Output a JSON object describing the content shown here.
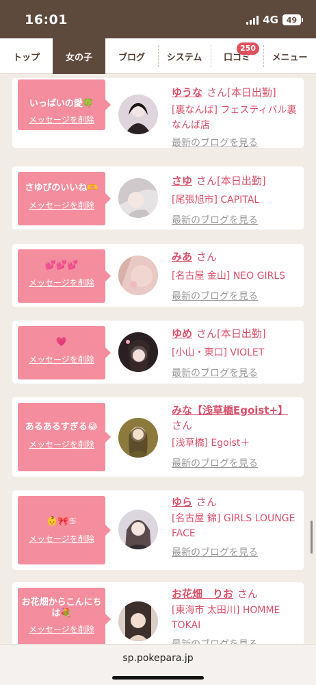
{
  "status": {
    "time": "16:01",
    "network": "4G",
    "battery": "49"
  },
  "nav": {
    "tabs": [
      {
        "label": "トップ"
      },
      {
        "label": "女の子"
      },
      {
        "label": "ブログ"
      },
      {
        "label": "システム"
      },
      {
        "label": "口コミ",
        "badge": "250"
      },
      {
        "label": "メニュー"
      }
    ]
  },
  "cards": [
    {
      "message": "いっぱいの愛🍀",
      "delete_label": "メッセージを削除",
      "name": "ゆうな",
      "honorific": "さん",
      "status": "[本日出勤]",
      "shop": "[裏なんば] フェスティバル裏なんば店",
      "blog_label": "最新のブログを見る"
    },
    {
      "message": "さゆぴのいいね🫶",
      "delete_label": "メッセージを削除",
      "name": "さゆ",
      "honorific": "さん",
      "status": "[本日出勤]",
      "shop": "[尾張旭市] CAPITAL",
      "blog_label": "最新のブログを見る"
    },
    {
      "message": "💕💕💕",
      "delete_label": "メッセージを削除",
      "name": "みあ",
      "honorific": "さん",
      "status": "",
      "shop": "[名古屋 金山] NEO GIRLS",
      "blog_label": "最新のブログを見る"
    },
    {
      "message": "💗",
      "delete_label": "メッセージを削除",
      "name": "ゆめ",
      "honorific": "さん",
      "status": "[本日出勤]",
      "shop": "[小山・東口] VIOLET",
      "blog_label": "最新のブログを見る"
    },
    {
      "message": "あるあるすぎる😂",
      "delete_label": "メッセージを削除",
      "name": "みな【浅草橋Egoist+】",
      "honorific": "さん",
      "status": "",
      "shop": "[浅草橋] Egoist＋",
      "blog_label": "最新のブログを見る"
    },
    {
      "message": "👶🎀♋",
      "delete_label": "メッセージを削除",
      "name": "ゆら",
      "honorific": "さん",
      "status": "",
      "shop": "[名古屋 錦] GIRLS LOUNGE FACE",
      "blog_label": "最新のブログを見る"
    },
    {
      "message": "お花畑からこんにちは💐",
      "delete_label": "メッセージを削除",
      "name": "お花畑　りお",
      "honorific": "さん",
      "status": "",
      "shop": "[東海市 太田川] HOMME TOKAI",
      "blog_label": "最新のブログを見る"
    }
  ],
  "browser": {
    "url": "sp.pokepara.jp"
  },
  "colors": {
    "accent": "#d8506a",
    "bubble": "#f48d9e",
    "header": "#5e4a3c"
  }
}
